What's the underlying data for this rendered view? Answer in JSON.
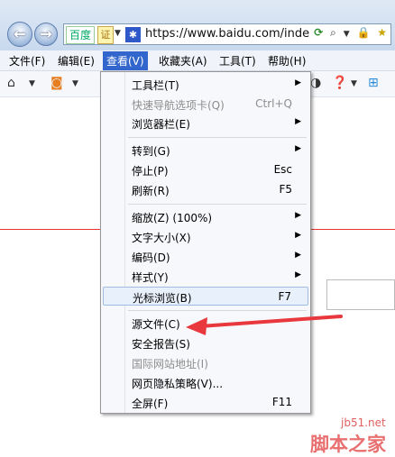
{
  "address_bar": {
    "baidu_label": "百度",
    "cert_label": "证",
    "url": "https://www.baidu.com/inde",
    "icons": [
      "refresh-icon",
      "search-icon",
      "lock-icon",
      "star-icon"
    ]
  },
  "menubar": {
    "items": [
      {
        "label": "文件(F)"
      },
      {
        "label": "编辑(E)"
      },
      {
        "label": "查看(V)"
      },
      {
        "label": "收藏夹(A)"
      },
      {
        "label": "工具(T)"
      },
      {
        "label": "帮助(H)"
      }
    ]
  },
  "dropdown": {
    "items": [
      {
        "label": "工具栏(T)",
        "shortcut": "",
        "submenu": true
      },
      {
        "label": "快速导航选项卡(Q)",
        "shortcut": "Ctrl+Q",
        "disabled": true
      },
      {
        "label": "浏览器栏(E)",
        "shortcut": "",
        "submenu": true
      },
      {
        "label": "转到(G)",
        "shortcut": "",
        "submenu": true
      },
      {
        "label": "停止(P)",
        "shortcut": "Esc"
      },
      {
        "label": "刷新(R)",
        "shortcut": "F5"
      },
      {
        "label": "缩放(Z) (100%)",
        "shortcut": "",
        "submenu": true
      },
      {
        "label": "文字大小(X)",
        "shortcut": "",
        "submenu": true
      },
      {
        "label": "编码(D)",
        "shortcut": "",
        "submenu": true
      },
      {
        "label": "样式(Y)",
        "shortcut": "",
        "submenu": true
      },
      {
        "label": "光标浏览(B)",
        "shortcut": "F7",
        "highlighted": true
      },
      {
        "label": "源文件(C)",
        "shortcut": ""
      },
      {
        "label": "安全报告(S)",
        "shortcut": ""
      },
      {
        "label": "国际网站地址(I)",
        "shortcut": "",
        "disabled": true
      },
      {
        "label": "网页隐私策略(V)...",
        "shortcut": ""
      },
      {
        "label": "全屏(F)",
        "shortcut": "F11"
      }
    ]
  },
  "watermark": {
    "site": "jb51.net",
    "brand": "脚本之家"
  },
  "colors": {
    "menu_active": "#3366cc",
    "annotation_arrow": "#e8383d"
  }
}
